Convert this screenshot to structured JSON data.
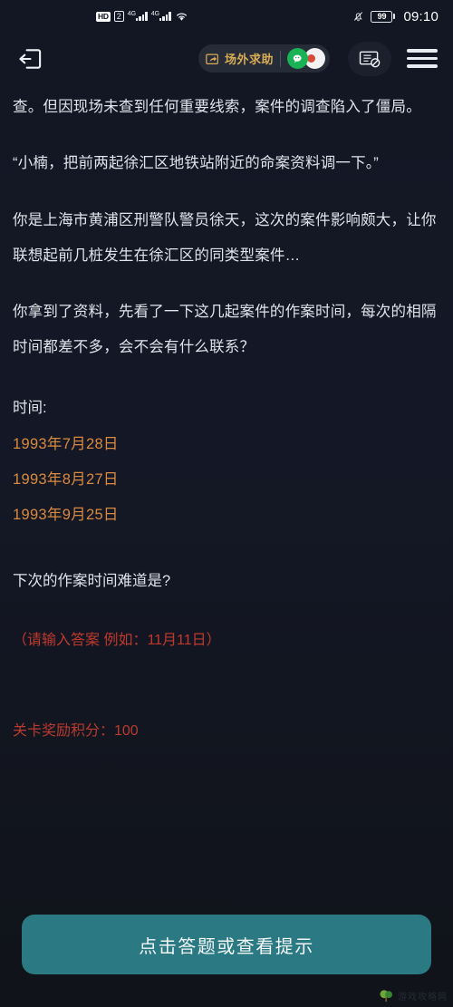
{
  "statusbar": {
    "hd_label": "HD",
    "sim_label": "2",
    "network_1": "4G",
    "network_2": "4G",
    "battery_percent": "99",
    "time": "09:10",
    "icons": [
      "hd-icon",
      "sim-icon",
      "signal-icon",
      "signal-icon",
      "wifi-icon",
      "bell-muted-icon",
      "battery-icon"
    ]
  },
  "toolbar": {
    "exit_icon": "exit-icon",
    "help_label": "场外求助",
    "share_icon": "share-icon",
    "wechat_icon": "wechat-icon",
    "notes_icon": "notes-disabled-icon",
    "menu_icon": "hamburger-menu-icon"
  },
  "story": {
    "paragraph_1": "查。但因现场未查到任何重要线索，案件的调查陷入了僵局。",
    "paragraph_2": "“小楠，把前两起徐汇区地铁站附近的命案资料调一下。”",
    "paragraph_3": "你是上海市黄浦区刑警队警员徐天，这次的案件影响颇大，让你联想起前几桩发生在徐汇区的同类型案件…",
    "paragraph_4": "你拿到了资料，先看了一下这几起案件的作案时间，每次的相隔时间都差不多，会不会有什么联系？"
  },
  "clues": {
    "time_label": "时间:",
    "dates": [
      "1993年7月28日",
      "1993年8月27日",
      "1993年9月25日"
    ]
  },
  "question": {
    "prompt": "下次的作案时间难道是?",
    "input_hint": "（请输入答案 例如：11月11日）",
    "reward": "关卡奖励积分：100"
  },
  "footer": {
    "answer_button": "点击答题或查看提示",
    "watermark_text": "游戏攻略网",
    "watermark_icon": "tree-logo-icon"
  },
  "colors": {
    "background": "#131724",
    "text": "#dfe3ea",
    "date_accent": "#d98a3e",
    "hint_red": "#c0392b",
    "button_teal": "#2b7a83",
    "help_gold": "#d8ac55"
  }
}
